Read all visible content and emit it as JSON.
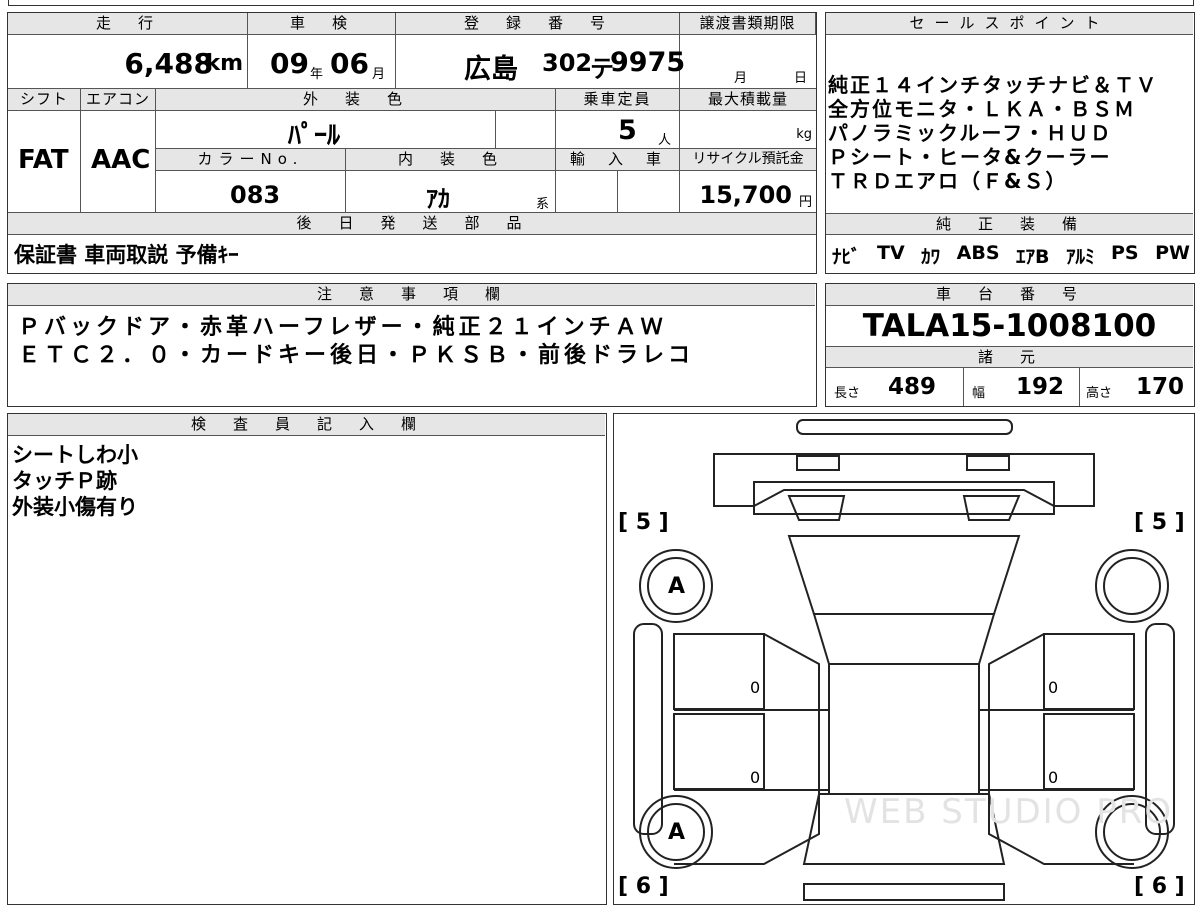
{
  "top": {
    "h_mileage": "走　行",
    "mileage": "6,488",
    "mileage_unit": "km",
    "h_shaken": "車　検",
    "shaken_year": "09",
    "shaken_year_unit": "年",
    "shaken_month": "06",
    "shaken_month_unit": "月",
    "h_reg": "登　録　番　号",
    "reg_area": "広島",
    "reg_class": "302",
    "reg_kana": "テ",
    "reg_num": "9975",
    "h_deadline": "譲渡書類期限",
    "deadline_month": "月",
    "deadline_day": "日"
  },
  "row2": {
    "h_shift": "シフト",
    "h_aircon": "エアコン",
    "h_exterior": "外　装　色",
    "h_capacity": "乗車定員",
    "h_maxload": "最大積載量",
    "shift": "FAT",
    "aircon": "AAC",
    "exterior": "ﾊﾟｰﾙ",
    "capacity": "5",
    "capacity_unit": "人",
    "maxload_unit": "kg",
    "h_colorno": "カラーNo.",
    "h_interior": "内　装　色",
    "h_import": "輸　入　車",
    "h_recycle": "リサイクル預託金",
    "colorno": "083",
    "interior": "ｱｶ",
    "interior_unit": "系",
    "recycle": "15,700",
    "recycle_unit": "円"
  },
  "later": {
    "header": "後　日　発　送　部　品",
    "items": "保証書 車両取説 予備ｷｰ"
  },
  "sales": {
    "header": "セールスポイント",
    "lines": [
      "純正１４インチタッチナビ＆ＴＶ",
      "全方位モニタ・ＬＫＡ・ＢＳＭ",
      "パノラミックルーフ・ＨＵＤ",
      "Ｐシート・ヒータ&クーラー",
      "ＴＲＤエアロ（Ｆ&Ｓ）"
    ]
  },
  "equip": {
    "header": "純　正　装　備",
    "items": [
      "ﾅﾋﾞ",
      "TV",
      "ｶﾜ",
      "ABS",
      "ｴｱB",
      "ｱﾙﾐ",
      "PS",
      "PW"
    ]
  },
  "caution": {
    "header": "注　意　事　項　欄",
    "lines": [
      "Ｐバックドア・赤革ハーフレザー・純正２１インチＡＷ",
      "ＥＴＣ２．０・カードキー後日・ＰＫＳＢ・前後ドラレコ"
    ]
  },
  "chassis": {
    "header": "車　台　番　号",
    "number": "TALA15-1008100",
    "spec_header": "諸　元",
    "len_label": "長さ",
    "len": "489",
    "wid_label": "幅",
    "wid": "192",
    "hei_label": "高さ",
    "hei": "170"
  },
  "inspector": {
    "header": "検　査　員　記　入　欄",
    "lines": [
      "シートしわ小",
      "タッチＰ跡",
      "外装小傷有り"
    ]
  },
  "diagram": {
    "tl": "[ 5 ]",
    "tr": "[ 5 ]",
    "bl": "[ 6 ]",
    "br": "[ 6 ]",
    "wheel_fl": "A",
    "wheel_rl": "A",
    "mark_l1": "0",
    "mark_l2": "0",
    "mark_r1": "0",
    "mark_r2": "0",
    "watermark": "WEB STUDIO PRO"
  }
}
